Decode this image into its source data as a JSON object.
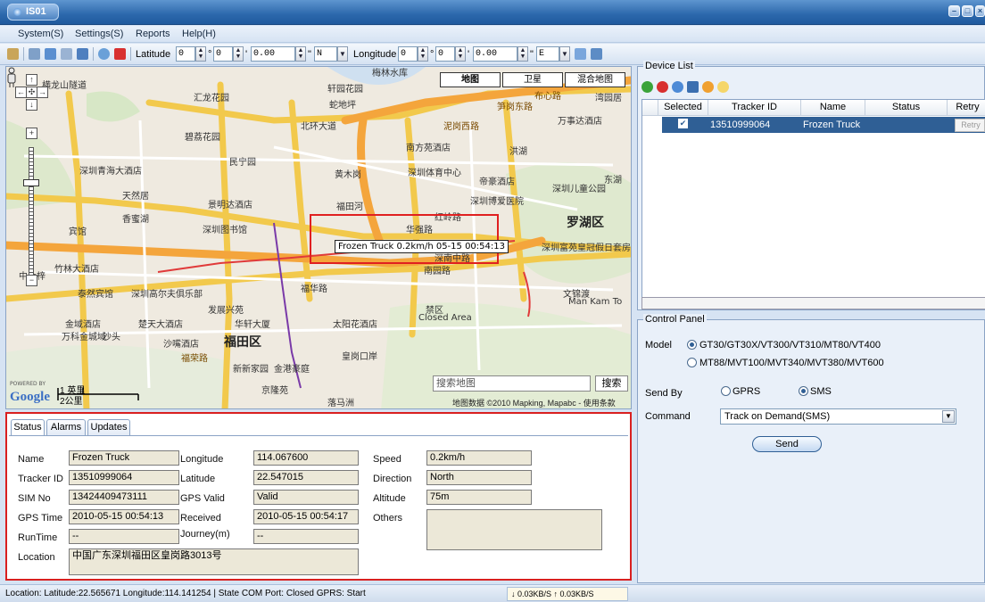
{
  "window": {
    "badge": "IS01",
    "min": "–",
    "max": "□",
    "close": "×"
  },
  "menu": [
    "System(S)",
    "Settings(S)",
    "Reports",
    "Help(H)"
  ],
  "toolbar": {
    "latitude_label": "Latitude",
    "lat_deg": "0",
    "lat_min": "0",
    "lat_sec": "0.00",
    "lat_dir": "N",
    "longitude_label": "Longitude",
    "lon_deg": "0",
    "lon_min": "0",
    "lon_sec": "0.00",
    "lon_dir": "E",
    "deg_sym": "°",
    "min_sym": "'",
    "sec_sym": "\""
  },
  "map": {
    "tabs": [
      "地图",
      "卫星",
      "混合地图"
    ],
    "labels": [
      {
        "t": "梅林水库",
        "c": "water"
      },
      {
        "t": "横龙山隧道"
      },
      {
        "t": "汇龙花园"
      },
      {
        "t": "轩园花园"
      },
      {
        "t": "蛇地坪"
      },
      {
        "t": "北环大道"
      },
      {
        "t": "泥岗西路"
      },
      {
        "t": "笋岗东路"
      },
      {
        "t": "布心路"
      },
      {
        "t": "湾园居"
      },
      {
        "t": "万事达酒店"
      },
      {
        "t": "碧荔花园"
      },
      {
        "t": "南方苑酒店"
      },
      {
        "t": "洪湖"
      },
      {
        "t": "深圳青海大酒店"
      },
      {
        "t": "民宁园"
      },
      {
        "t": "黄木岗"
      },
      {
        "t": "深圳体育中心"
      },
      {
        "t": "帝豪酒店"
      },
      {
        "t": "深圳儿童公园"
      },
      {
        "t": "东湖"
      },
      {
        "t": "天然居"
      },
      {
        "t": "景明达酒店"
      },
      {
        "t": "福田河"
      },
      {
        "t": "深圳博爱医院"
      },
      {
        "t": "香蜜湖"
      },
      {
        "t": "深圳图书馆"
      },
      {
        "t": "华强路"
      },
      {
        "t": "红岭路"
      },
      {
        "t": "罗湖区",
        "c": "big"
      },
      {
        "t": "深圳富苑皇冠假日套房酒店"
      },
      {
        "t": "深南中路"
      },
      {
        "t": "南园路"
      },
      {
        "t": "竹林大酒店"
      },
      {
        "t": "宾馆"
      },
      {
        "t": "泰然宾馆"
      },
      {
        "t": "深圳高尔夫俱乐部"
      },
      {
        "t": "福华路"
      },
      {
        "t": "文锦渡"
      },
      {
        "t": "Man Kam To"
      },
      {
        "t": "发展兴苑"
      },
      {
        "t": "禁区"
      },
      {
        "t": "Closed Area"
      },
      {
        "t": "金域酒店"
      },
      {
        "t": "楚天大酒店"
      },
      {
        "t": "华轩大厦"
      },
      {
        "t": "太阳花酒店"
      },
      {
        "t": "万科金城域"
      },
      {
        "t": "沙头"
      },
      {
        "t": "沙嘴酒店"
      },
      {
        "t": "福田区",
        "c": "big"
      },
      {
        "t": "皇岗口岸"
      },
      {
        "t": "新新家园"
      },
      {
        "t": "金港豪庭"
      },
      {
        "t": "京隆苑"
      },
      {
        "t": "落马洲"
      },
      {
        "t": "中片梓"
      },
      {
        "t": "福荣路"
      }
    ],
    "tooltip": "Frozen Truck 0.2km/h 05-15 00:54:13",
    "search_placeholder": "搜索地图",
    "search_button": "搜索",
    "scale_km": "1 英里",
    "scale_mi": "2公里",
    "logo": "Google",
    "powered_by": "POWERED BY",
    "copyright": "地图数据 ©2010 Mapking, Mapabc - 使用条款"
  },
  "status": {
    "tabs": [
      "Status",
      "Alarms",
      "Updates"
    ],
    "fields": {
      "name": {
        "label": "Name",
        "value": "Frozen Truck"
      },
      "tracker_id": {
        "label": "Tracker ID",
        "value": "13510999064"
      },
      "sim": {
        "label": "SIM No",
        "value": "13424409473111"
      },
      "gps_time": {
        "label": "GPS Time",
        "value": "2010-05-15 00:54:13"
      },
      "runtime": {
        "label": "RunTime",
        "value": "--"
      },
      "location": {
        "label": "Location",
        "value": "中国广东深圳福田区皇岗路3013号"
      },
      "longitude": {
        "label": "Longitude",
        "value": "114.067600"
      },
      "latitude": {
        "label": "Latitude",
        "value": "22.547015"
      },
      "gps_valid": {
        "label": "GPS Valid",
        "value": "Valid"
      },
      "received": {
        "label": "Received",
        "value": "2010-05-15 00:54:17"
      },
      "journey": {
        "label": "Journey(m)",
        "value": "--"
      },
      "speed": {
        "label": "Speed",
        "value": "0.2km/h"
      },
      "direction": {
        "label": "Direction",
        "value": "North"
      },
      "altitude": {
        "label": "Altitude",
        "value": "75m"
      },
      "others": {
        "label": "Others",
        "value": ""
      }
    }
  },
  "device_list": {
    "title": "Device List",
    "columns": [
      "Selected",
      "Tracker ID",
      "Name",
      "Status",
      "Retry"
    ],
    "rows": [
      {
        "tracker_id": "13510999064",
        "name": "Frozen Truck",
        "status": "",
        "retry": "Retry"
      }
    ]
  },
  "control_panel": {
    "title": "Control Panel",
    "model_label": "Model",
    "model_a": "GT30/GT30X/VT300/VT310/MT80/VT400",
    "model_b": "MT88/MVT100/MVT340/MVT380/MVT600",
    "send_by_label": "Send By",
    "gprs": "GPRS",
    "sms": "SMS",
    "command_label": "Command",
    "command_value": "Track on Demand(SMS)",
    "send_button": "Send"
  },
  "statusbar": {
    "text": "Location: Latitude:22.565671 Longitude:114.141254  |  State COM Port: Closed  GPRS: Start",
    "speed": "↓ 0.03KB/S  ↑ 0.03KB/S"
  }
}
